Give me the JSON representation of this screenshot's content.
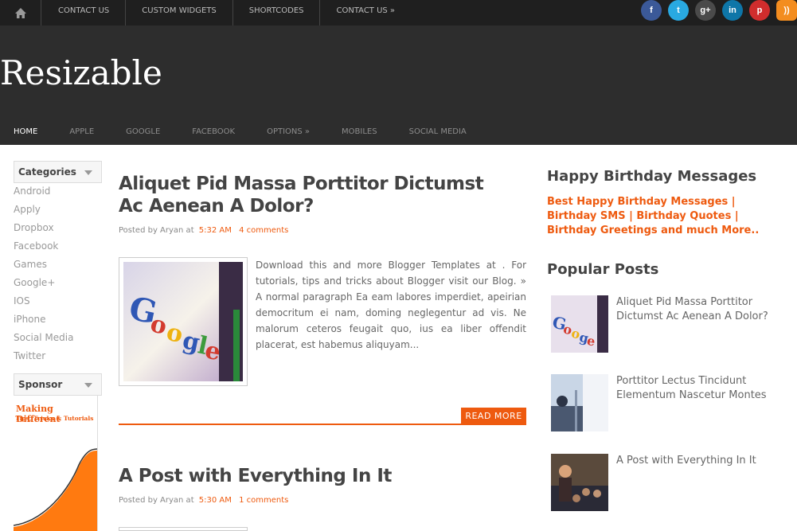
{
  "topbar": {
    "nav": [
      "CONTACT US",
      "CUSTOM WIDGETS",
      "SHORTCODES",
      "CONTACT US »"
    ],
    "social": [
      {
        "icon": "facebook-icon",
        "glyph": "f",
        "color": "#3b5998"
      },
      {
        "icon": "twitter-icon",
        "glyph": "t",
        "color": "#29a9e1"
      },
      {
        "icon": "googleplus-icon",
        "glyph": "g+",
        "color": "#4a4a4a"
      },
      {
        "icon": "linkedin-icon",
        "glyph": "in",
        "color": "#0e76a8"
      },
      {
        "icon": "pinterest-icon",
        "glyph": "p",
        "color": "#d02d2d"
      },
      {
        "icon": "rss-icon",
        "glyph": "))",
        "color": "#f38d1f"
      }
    ]
  },
  "header": {
    "logo": "Resizable",
    "nav": [
      "HOME",
      "APPLE",
      "GOOGLE",
      "FACEBOOK",
      "OPTIONS »",
      "MOBILES",
      "SOCIAL MEDIA"
    ]
  },
  "sidebar": {
    "categories_title": "Categories",
    "categories": [
      "Android",
      "Apply",
      "Dropbox",
      "Facebook",
      "Games",
      "Google+",
      "IOS",
      "iPhone",
      "Social Media",
      "Twitter"
    ],
    "sponsor_title": "Sponsor",
    "sponsor_text_1": "Making Different",
    "sponsor_text_2": "Tips, Tricks & Tutorials"
  },
  "posts": [
    {
      "title": "Aliquet Pid Massa Porttitor Dictumst Ac Aenean A Dolor?",
      "meta_prefix": "Posted by Aryan at",
      "time": "5:32 AM",
      "comments": "4 comments",
      "excerpt": "Download this and more Blogger Templates at . For tutorials, tips and tricks about Blogger visit our Blog. » A normal paragraph Ea eam labores imperdiet, apeirian democritum ei nam, doming neglegentur ad vis. Ne malorum ceteros feugait quo, ius ea liber offendit placerat, est habemus aliquyam...",
      "read_more": "READ MORE"
    },
    {
      "title": "A Post with Everything In It",
      "meta_prefix": "Posted by Aryan at",
      "time": "5:30 AM",
      "comments": "1 comments"
    }
  ],
  "right": {
    "birthday_title": "Happy Birthday Messages",
    "birthday_link": "Best Happy Birthday Messages | Birthday SMS | Birthday Quotes | Birthday Greetings and much More..",
    "popular_title": "Popular Posts",
    "popular": [
      "Aliquet Pid Massa Porttitor Dictumst Ac Aenean A Dolor?",
      "Porttitor Lectus Tincidunt Elementum Nascetur Montes",
      "A Post with Everything In It"
    ]
  },
  "colors": {
    "accent": "#ee5a0f",
    "topbar": "#1f1f1f",
    "header": "#2d2d2d"
  }
}
